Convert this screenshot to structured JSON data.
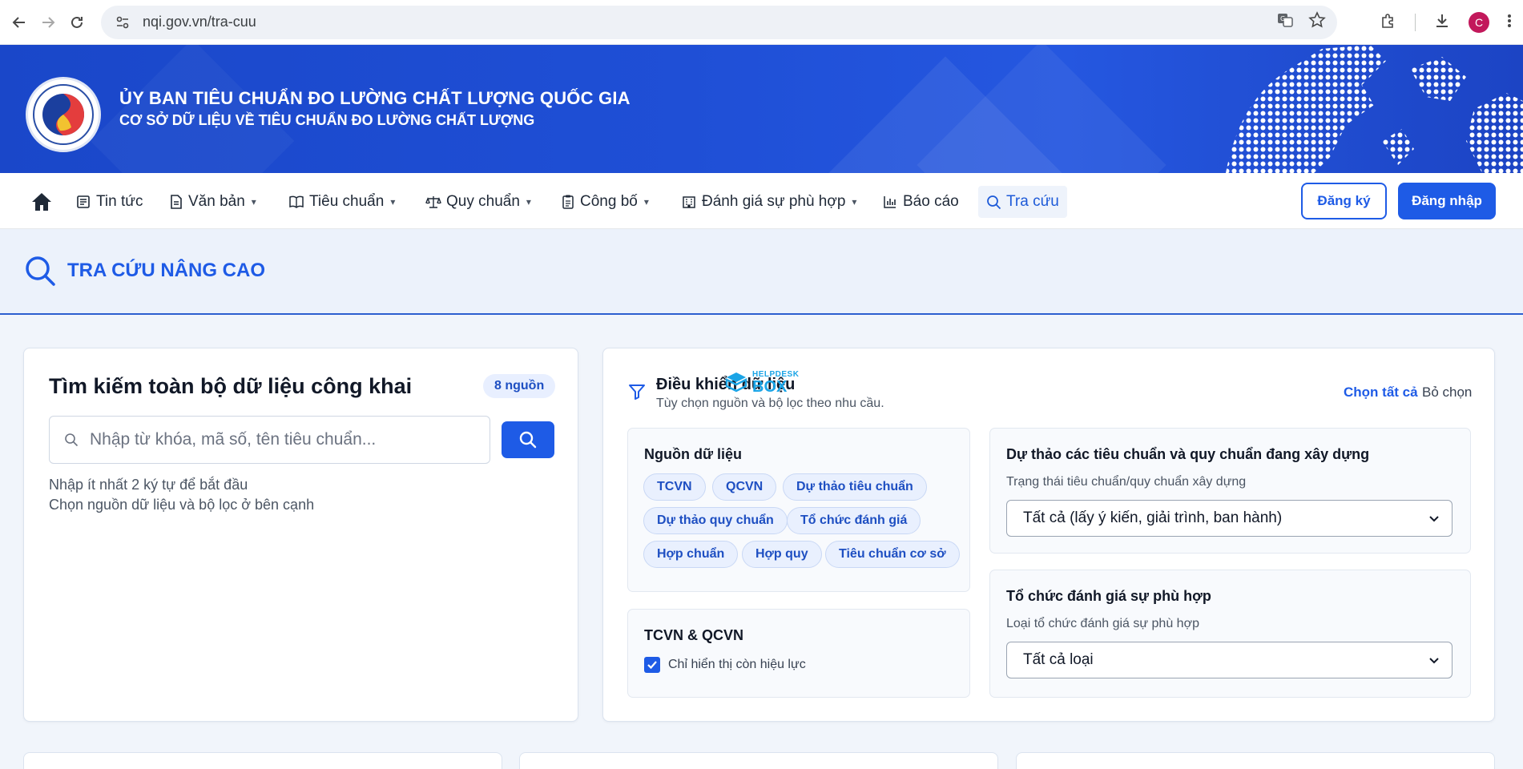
{
  "browser": {
    "url": "nqi.gov.vn/tra-cuu",
    "profile_initial": "C"
  },
  "banner": {
    "title": "ỦY BAN TIÊU CHUẨN ĐO LƯỜNG CHẤT LƯỢNG QUỐC GIA",
    "subtitle": "CƠ SỞ DỮ LIỆU VỀ TIÊU CHUẨN ĐO LƯỜNG CHẤT LƯỢNG"
  },
  "nav": {
    "items": [
      {
        "label": "Tin tức"
      },
      {
        "label": "Văn bản"
      },
      {
        "label": "Tiêu chuẩn"
      },
      {
        "label": "Quy chuẩn"
      },
      {
        "label": "Công bố"
      },
      {
        "label": "Đánh giá sự phù hợp"
      },
      {
        "label": "Báo cáo"
      },
      {
        "label": "Tra cứu"
      }
    ],
    "register": "Đăng ký",
    "login": "Đăng nhập"
  },
  "page": {
    "heading": "TRA CỨU NÂNG CAO"
  },
  "search": {
    "title": "Tìm kiếm toàn bộ dữ liệu công khai",
    "badge": "8 nguồn",
    "placeholder": "Nhập từ khóa, mã số, tên tiêu chuẩn...",
    "hint1": "Nhập ít nhất 2 ký tự để bắt đầu",
    "hint2": "Chọn nguồn dữ liệu và bộ lọc ở bên cạnh"
  },
  "filters": {
    "title": "Điều khiển dữ liệu",
    "subtitle": "Tùy chọn nguồn và bộ lọc theo nhu cầu.",
    "select_all": "Chọn tất cả",
    "clear": "Bỏ chọn",
    "watermark_top": "HELPDESK",
    "watermark_bottom": "BOX",
    "sources": {
      "title": "Nguồn dữ liệu",
      "chips": [
        "TCVN",
        "QCVN",
        "Dự thảo tiêu chuẩn",
        "Dự thảo quy chuẩn",
        "Tổ chức đánh giá",
        "Hợp chuẩn",
        "Hợp quy",
        "Tiêu chuẩn cơ sở"
      ]
    },
    "tcqc": {
      "title": "TCVN & QCVN",
      "checkbox_label": "Chỉ hiển thị còn hiệu lực",
      "checked": true
    },
    "draft": {
      "title": "Dự thảo các tiêu chuẩn và quy chuẩn đang xây dựng",
      "label": "Trạng thái tiêu chuẩn/quy chuẩn xây dựng",
      "value": "Tất cả (lấy ý kiến, giải trình, ban hành)"
    },
    "org": {
      "title": "Tổ chức đánh giá sự phù hợp",
      "label": "Loại tổ chức đánh giá sự phù hợp",
      "value": "Tất cả loại"
    }
  },
  "colors": {
    "primary": "#1e5be6",
    "banner": "#1f4fd6",
    "chip_bg": "#e9f0fe"
  }
}
